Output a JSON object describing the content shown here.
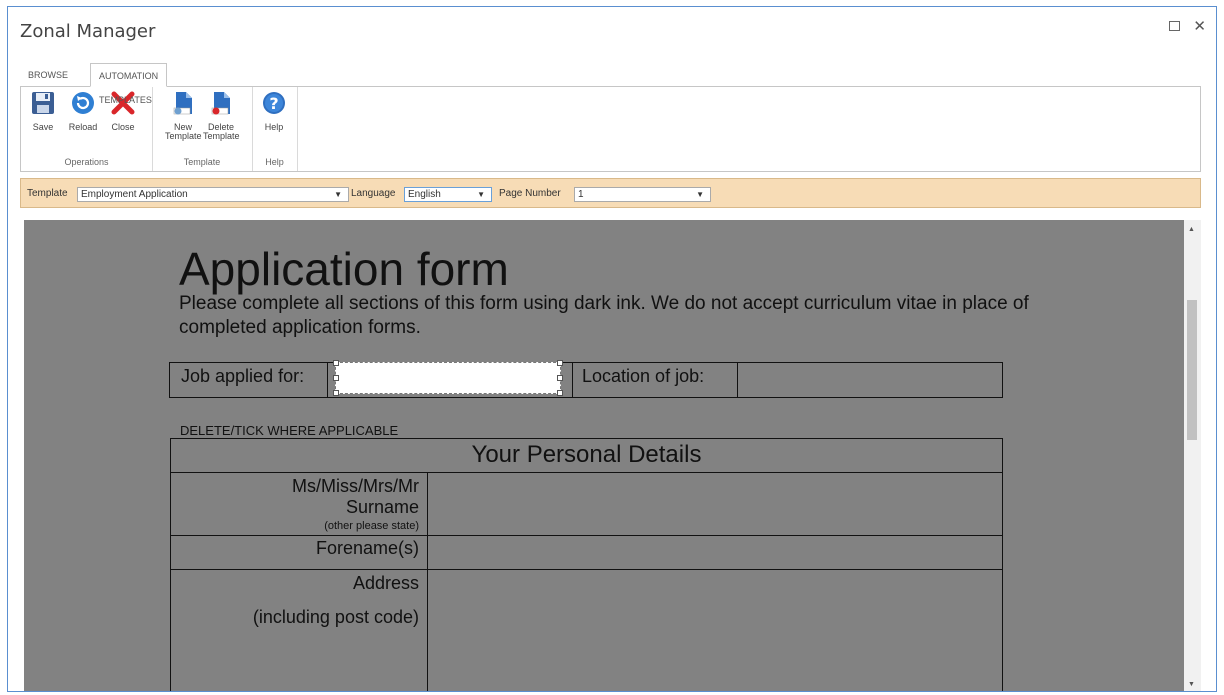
{
  "window": {
    "title": "Zonal Manager",
    "maximize_glyph": "",
    "close_glyph": "✕"
  },
  "tabs": [
    {
      "label": "BROWSE"
    },
    {
      "label": "AUTOMATION TEMPLATES"
    }
  ],
  "ribbon": {
    "groups": [
      {
        "label": "Operations",
        "buttons": [
          {
            "label": "Save",
            "icon": "save-icon"
          },
          {
            "label": "Reload",
            "icon": "reload-icon"
          },
          {
            "label": "Close",
            "icon": "close-icon"
          }
        ]
      },
      {
        "label": "Template",
        "buttons": [
          {
            "label_line1": "New",
            "label_line2": "Template",
            "icon": "new-template-icon"
          },
          {
            "label_line1": "Delete",
            "label_line2": "Template",
            "icon": "delete-template-icon"
          }
        ]
      },
      {
        "label": "Help",
        "buttons": [
          {
            "label": "Help",
            "icon": "help-icon"
          }
        ]
      }
    ]
  },
  "toolbar": {
    "template_label": "Template",
    "template_value": "Employment Application",
    "language_label": "Language",
    "language_value": "English",
    "page_label": "Page Number",
    "page_value": "1",
    "accent_color": "#f7dcb6"
  },
  "document": {
    "title": "Application form",
    "intro": "Please complete all sections of this form using dark ink. We do not accept curriculum vitae in place of completed application forms.",
    "job_applied_label": "Job applied for:",
    "location_label": "Location of job:",
    "delete_tick": "DELETE/TICK WHERE APPLICABLE",
    "section_title": "Your Personal Details",
    "rows": {
      "title_line": "Ms/Miss/Mrs/Mr",
      "surname": "Surname",
      "other_state": "(other please state)",
      "forenames": "Forename(s)",
      "address": "Address",
      "post_code": "(including post code)"
    }
  }
}
